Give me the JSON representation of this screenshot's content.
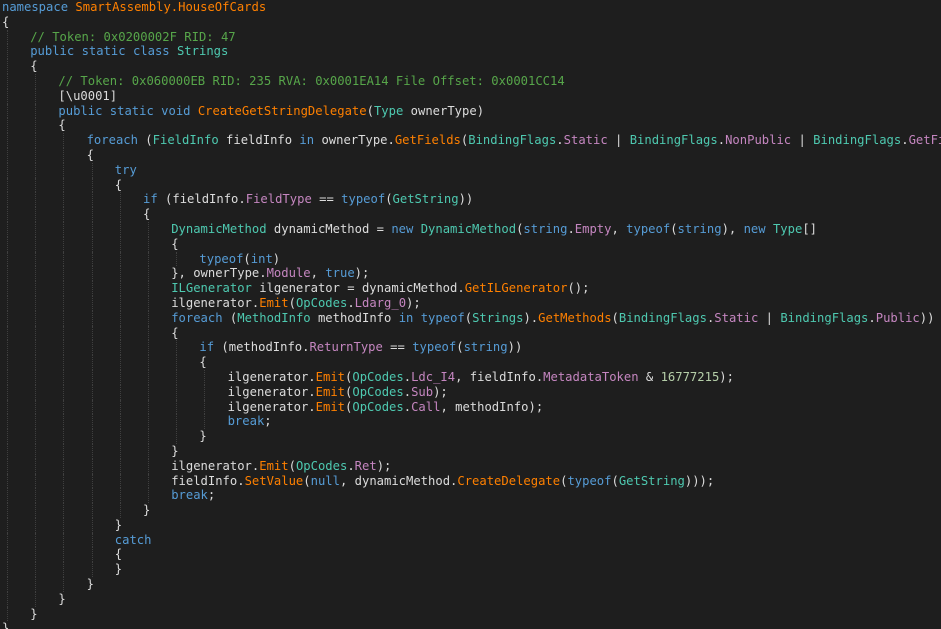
{
  "colors": {
    "background": "#1e1e1e",
    "keyword": "#569cd6",
    "type": "#4ec9b0",
    "method": "#ff8000",
    "property": "#c586c0",
    "comment": "#57a64a",
    "number": "#b5cea8",
    "text": "#dcdcdc"
  },
  "code": {
    "lines": [
      {
        "indent": 0,
        "tokens": [
          {
            "t": "namespace",
            "c": "kw"
          },
          {
            "t": " "
          },
          {
            "t": "SmartAssembly.HouseOfCards",
            "c": "me"
          }
        ]
      },
      {
        "indent": 0,
        "tokens": [
          {
            "t": "{"
          }
        ]
      },
      {
        "indent": 1,
        "tokens": [
          {
            "t": "// Token: 0x0200002F RID: 47",
            "c": "cm"
          }
        ]
      },
      {
        "indent": 1,
        "tokens": [
          {
            "t": "public",
            "c": "kw"
          },
          {
            "t": " "
          },
          {
            "t": "static",
            "c": "kw"
          },
          {
            "t": " "
          },
          {
            "t": "class",
            "c": "kw"
          },
          {
            "t": " "
          },
          {
            "t": "Strings",
            "c": "ty"
          }
        ]
      },
      {
        "indent": 1,
        "tokens": [
          {
            "t": "{"
          }
        ]
      },
      {
        "indent": 2,
        "tokens": [
          {
            "t": "// Token: 0x060000EB RID: 235 RVA: 0x0001EA14 File Offset: 0x0001CC14",
            "c": "cm"
          }
        ]
      },
      {
        "indent": 2,
        "tokens": [
          {
            "t": "[\\u0001]"
          }
        ]
      },
      {
        "indent": 2,
        "tokens": [
          {
            "t": "public",
            "c": "kw"
          },
          {
            "t": " "
          },
          {
            "t": "static",
            "c": "kw"
          },
          {
            "t": " "
          },
          {
            "t": "void",
            "c": "kw"
          },
          {
            "t": " "
          },
          {
            "t": "CreateGetStringDelegate",
            "c": "me"
          },
          {
            "t": "("
          },
          {
            "t": "Type",
            "c": "ty"
          },
          {
            "t": " "
          },
          {
            "t": "ownerType",
            "c": "pa"
          },
          {
            "t": ")"
          }
        ]
      },
      {
        "indent": 2,
        "tokens": [
          {
            "t": "{"
          }
        ]
      },
      {
        "indent": 3,
        "tokens": [
          {
            "t": "foreach",
            "c": "kw"
          },
          {
            "t": " ("
          },
          {
            "t": "FieldInfo",
            "c": "ty"
          },
          {
            "t": " fieldInfo "
          },
          {
            "t": "in",
            "c": "kw"
          },
          {
            "t": " "
          },
          {
            "t": "ownerType",
            "c": "pa"
          },
          {
            "t": "."
          },
          {
            "t": "GetFields",
            "c": "me"
          },
          {
            "t": "("
          },
          {
            "t": "BindingFlags",
            "c": "ty"
          },
          {
            "t": "."
          },
          {
            "t": "Static",
            "c": "pr"
          },
          {
            "t": " | "
          },
          {
            "t": "BindingFlags",
            "c": "ty"
          },
          {
            "t": "."
          },
          {
            "t": "NonPublic",
            "c": "pr"
          },
          {
            "t": " | "
          },
          {
            "t": "BindingFlags",
            "c": "ty"
          },
          {
            "t": "."
          },
          {
            "t": "GetField",
            "c": "pr"
          },
          {
            "t": "))"
          }
        ]
      },
      {
        "indent": 3,
        "tokens": [
          {
            "t": "{"
          }
        ]
      },
      {
        "indent": 4,
        "tokens": [
          {
            "t": "try",
            "c": "kw"
          }
        ]
      },
      {
        "indent": 4,
        "tokens": [
          {
            "t": "{"
          }
        ]
      },
      {
        "indent": 5,
        "tokens": [
          {
            "t": "if",
            "c": "kw"
          },
          {
            "t": " (fieldInfo."
          },
          {
            "t": "FieldType",
            "c": "pr"
          },
          {
            "t": " == "
          },
          {
            "t": "typeof",
            "c": "kw"
          },
          {
            "t": "("
          },
          {
            "t": "GetString",
            "c": "ty"
          },
          {
            "t": "))"
          }
        ]
      },
      {
        "indent": 5,
        "tokens": [
          {
            "t": "{"
          }
        ]
      },
      {
        "indent": 6,
        "tokens": [
          {
            "t": "DynamicMethod",
            "c": "ty"
          },
          {
            "t": " dynamicMethod = "
          },
          {
            "t": "new",
            "c": "kw"
          },
          {
            "t": " "
          },
          {
            "t": "DynamicMethod",
            "c": "ty"
          },
          {
            "t": "("
          },
          {
            "t": "string",
            "c": "kw"
          },
          {
            "t": "."
          },
          {
            "t": "Empty",
            "c": "pr"
          },
          {
            "t": ", "
          },
          {
            "t": "typeof",
            "c": "kw"
          },
          {
            "t": "("
          },
          {
            "t": "string",
            "c": "kw"
          },
          {
            "t": "), "
          },
          {
            "t": "new",
            "c": "kw"
          },
          {
            "t": " "
          },
          {
            "t": "Type",
            "c": "ty"
          },
          {
            "t": "[]"
          }
        ]
      },
      {
        "indent": 6,
        "tokens": [
          {
            "t": "{"
          }
        ]
      },
      {
        "indent": 7,
        "tokens": [
          {
            "t": "typeof",
            "c": "kw"
          },
          {
            "t": "("
          },
          {
            "t": "int",
            "c": "kw"
          },
          {
            "t": ")"
          }
        ]
      },
      {
        "indent": 6,
        "tokens": [
          {
            "t": "}, "
          },
          {
            "t": "ownerType",
            "c": "pa"
          },
          {
            "t": "."
          },
          {
            "t": "Module",
            "c": "pr"
          },
          {
            "t": ", "
          },
          {
            "t": "true",
            "c": "kw"
          },
          {
            "t": ");"
          }
        ]
      },
      {
        "indent": 6,
        "tokens": [
          {
            "t": "ILGenerator",
            "c": "ty"
          },
          {
            "t": " ilgenerator = dynamicMethod."
          },
          {
            "t": "GetILGenerator",
            "c": "me"
          },
          {
            "t": "();"
          }
        ]
      },
      {
        "indent": 6,
        "tokens": [
          {
            "t": "ilgenerator."
          },
          {
            "t": "Emit",
            "c": "me"
          },
          {
            "t": "("
          },
          {
            "t": "OpCodes",
            "c": "ty"
          },
          {
            "t": "."
          },
          {
            "t": "Ldarg_0",
            "c": "pr"
          },
          {
            "t": ");"
          }
        ]
      },
      {
        "indent": 6,
        "tokens": [
          {
            "t": "foreach",
            "c": "kw"
          },
          {
            "t": " ("
          },
          {
            "t": "MethodInfo",
            "c": "ty"
          },
          {
            "t": " methodInfo "
          },
          {
            "t": "in",
            "c": "kw"
          },
          {
            "t": " "
          },
          {
            "t": "typeof",
            "c": "kw"
          },
          {
            "t": "("
          },
          {
            "t": "Strings",
            "c": "ty"
          },
          {
            "t": ")."
          },
          {
            "t": "GetMethods",
            "c": "me"
          },
          {
            "t": "("
          },
          {
            "t": "BindingFlags",
            "c": "ty"
          },
          {
            "t": "."
          },
          {
            "t": "Static",
            "c": "pr"
          },
          {
            "t": " | "
          },
          {
            "t": "BindingFlags",
            "c": "ty"
          },
          {
            "t": "."
          },
          {
            "t": "Public",
            "c": "pr"
          },
          {
            "t": "))"
          }
        ]
      },
      {
        "indent": 6,
        "tokens": [
          {
            "t": "{"
          }
        ]
      },
      {
        "indent": 7,
        "tokens": [
          {
            "t": "if",
            "c": "kw"
          },
          {
            "t": " (methodInfo."
          },
          {
            "t": "ReturnType",
            "c": "pr"
          },
          {
            "t": " == "
          },
          {
            "t": "typeof",
            "c": "kw"
          },
          {
            "t": "("
          },
          {
            "t": "string",
            "c": "kw"
          },
          {
            "t": "))"
          }
        ]
      },
      {
        "indent": 7,
        "tokens": [
          {
            "t": "{"
          }
        ]
      },
      {
        "indent": 8,
        "tokens": [
          {
            "t": "ilgenerator."
          },
          {
            "t": "Emit",
            "c": "me"
          },
          {
            "t": "("
          },
          {
            "t": "OpCodes",
            "c": "ty"
          },
          {
            "t": "."
          },
          {
            "t": "Ldc_I4",
            "c": "pr"
          },
          {
            "t": ", fieldInfo."
          },
          {
            "t": "MetadataToken",
            "c": "pr"
          },
          {
            "t": " & "
          },
          {
            "t": "16777215",
            "c": "nm"
          },
          {
            "t": ");"
          }
        ]
      },
      {
        "indent": 8,
        "tokens": [
          {
            "t": "ilgenerator."
          },
          {
            "t": "Emit",
            "c": "me"
          },
          {
            "t": "("
          },
          {
            "t": "OpCodes",
            "c": "ty"
          },
          {
            "t": "."
          },
          {
            "t": "Sub",
            "c": "pr"
          },
          {
            "t": ");"
          }
        ]
      },
      {
        "indent": 8,
        "tokens": [
          {
            "t": "ilgenerator."
          },
          {
            "t": "Emit",
            "c": "me"
          },
          {
            "t": "("
          },
          {
            "t": "OpCodes",
            "c": "ty"
          },
          {
            "t": "."
          },
          {
            "t": "Call",
            "c": "pr"
          },
          {
            "t": ", methodInfo);"
          }
        ]
      },
      {
        "indent": 8,
        "tokens": [
          {
            "t": "break",
            "c": "kw"
          },
          {
            "t": ";"
          }
        ]
      },
      {
        "indent": 7,
        "tokens": [
          {
            "t": "}"
          }
        ]
      },
      {
        "indent": 6,
        "tokens": [
          {
            "t": "}"
          }
        ]
      },
      {
        "indent": 6,
        "tokens": [
          {
            "t": "ilgenerator."
          },
          {
            "t": "Emit",
            "c": "me"
          },
          {
            "t": "("
          },
          {
            "t": "OpCodes",
            "c": "ty"
          },
          {
            "t": "."
          },
          {
            "t": "Ret",
            "c": "pr"
          },
          {
            "t": ");"
          }
        ]
      },
      {
        "indent": 6,
        "tokens": [
          {
            "t": "fieldInfo."
          },
          {
            "t": "SetValue",
            "c": "me"
          },
          {
            "t": "("
          },
          {
            "t": "null",
            "c": "kw"
          },
          {
            "t": ", dynamicMethod."
          },
          {
            "t": "CreateDelegate",
            "c": "me"
          },
          {
            "t": "("
          },
          {
            "t": "typeof",
            "c": "kw"
          },
          {
            "t": "("
          },
          {
            "t": "GetString",
            "c": "ty"
          },
          {
            "t": ")));"
          }
        ]
      },
      {
        "indent": 6,
        "tokens": [
          {
            "t": "break",
            "c": "kw"
          },
          {
            "t": ";"
          }
        ]
      },
      {
        "indent": 5,
        "tokens": [
          {
            "t": "}"
          }
        ]
      },
      {
        "indent": 4,
        "tokens": [
          {
            "t": "}"
          }
        ]
      },
      {
        "indent": 4,
        "tokens": [
          {
            "t": "catch",
            "c": "kw"
          }
        ]
      },
      {
        "indent": 4,
        "tokens": [
          {
            "t": "{"
          }
        ]
      },
      {
        "indent": 4,
        "tokens": [
          {
            "t": "}"
          }
        ]
      },
      {
        "indent": 3,
        "tokens": [
          {
            "t": "}"
          }
        ]
      },
      {
        "indent": 2,
        "tokens": [
          {
            "t": "}"
          }
        ]
      },
      {
        "indent": 1,
        "tokens": [
          {
            "t": "}"
          }
        ]
      },
      {
        "indent": 0,
        "tokens": [
          {
            "t": "}"
          }
        ]
      }
    ]
  }
}
